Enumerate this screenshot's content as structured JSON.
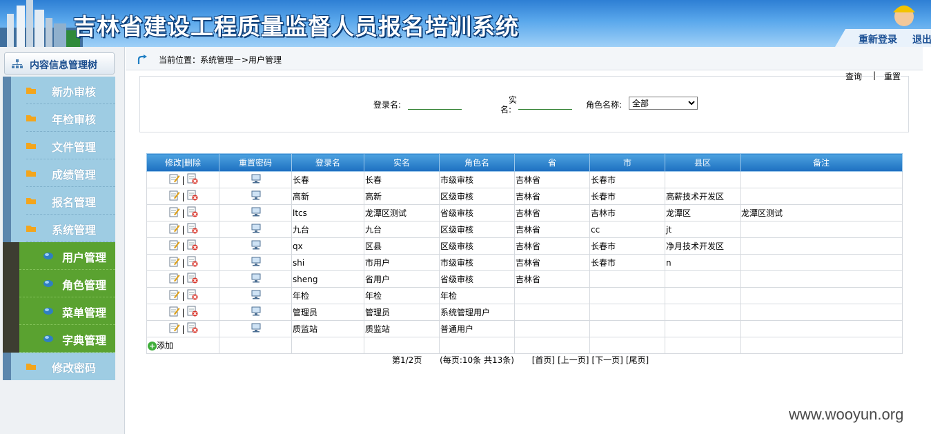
{
  "header": {
    "title": "吉林省建设工程质量监督人员报名培训系统",
    "relogin": "重新登录",
    "logout": "退出"
  },
  "sidebar": {
    "tree_title": "内容信息管理树",
    "items": [
      {
        "label": "新办审核",
        "icon": "folder-arrow-icon"
      },
      {
        "label": "年检审核",
        "icon": "folder-arrow-icon"
      },
      {
        "label": "文件管理",
        "icon": "folder-arrow-icon"
      },
      {
        "label": "成绩管理",
        "icon": "folder-arrow-icon"
      },
      {
        "label": "报名管理",
        "icon": "folder-arrow-icon"
      },
      {
        "label": "系统管理",
        "icon": "folder-arrow-icon"
      }
    ],
    "sub_items": [
      {
        "label": "用户管理"
      },
      {
        "label": "角色管理"
      },
      {
        "label": "菜单管理"
      },
      {
        "label": "字典管理"
      }
    ],
    "last_item": {
      "label": "修改密码"
    }
  },
  "breadcrumb": "当前位置：系统管理－>用户管理",
  "search": {
    "query": "查询",
    "divider": "|",
    "reset": "重置",
    "login_label": "登录名:",
    "realname_label_1": "实",
    "realname_label_2": "名:",
    "role_label": "角色名称:",
    "role_selected": "全部",
    "login_value": "",
    "realname_value": ""
  },
  "table": {
    "headers": [
      "修改|删除",
      "重置密码",
      "登录名",
      "实名",
      "角色名",
      "省",
      "市",
      "县区",
      "备注"
    ],
    "rows": [
      {
        "login": "长春",
        "real": "长春",
        "role": "市级审核",
        "prov": "吉林省",
        "city": "长春市",
        "county": "",
        "note": ""
      },
      {
        "login": "高新",
        "real": "高新",
        "role": "区级审核",
        "prov": "吉林省",
        "city": "长春市",
        "county": "高薪技术开发区",
        "note": ""
      },
      {
        "login": "ltcs",
        "real": "龙潭区测试",
        "role": "省级审核",
        "prov": "吉林省",
        "city": "吉林市",
        "county": "龙潭区",
        "note": "龙潭区测试"
      },
      {
        "login": "九台",
        "real": "九台",
        "role": "区级审核",
        "prov": "吉林省",
        "city": "cc",
        "county": "jt",
        "note": ""
      },
      {
        "login": "qx",
        "real": "区县",
        "role": "区级审核",
        "prov": "吉林省",
        "city": "长春市",
        "county": "净月技术开发区",
        "note": ""
      },
      {
        "login": "shi",
        "real": "市用户",
        "role": "市级审核",
        "prov": "吉林省",
        "city": "长春市",
        "county": "n",
        "note": ""
      },
      {
        "login": "sheng",
        "real": "省用户",
        "role": "省级审核",
        "prov": "吉林省",
        "city": "",
        "county": "",
        "note": ""
      },
      {
        "login": "年检",
        "real": "年检",
        "role": "年检",
        "prov": "",
        "city": "",
        "county": "",
        "note": ""
      },
      {
        "login": "管理员",
        "real": "管理员",
        "role": "系统管理用户",
        "prov": "",
        "city": "",
        "county": "",
        "note": ""
      },
      {
        "login": "质监站",
        "real": "质监站",
        "role": "普通用户",
        "prov": "",
        "city": "",
        "county": "",
        "note": ""
      }
    ],
    "add_label": "添加"
  },
  "pager": {
    "page": "第1/2页",
    "info": "(每页:10条 共13条)",
    "first": "[首页]",
    "prev": "[上一页]",
    "next": "[下一页]",
    "last": "[尾页]"
  },
  "watermark": "www.wooyun.org"
}
